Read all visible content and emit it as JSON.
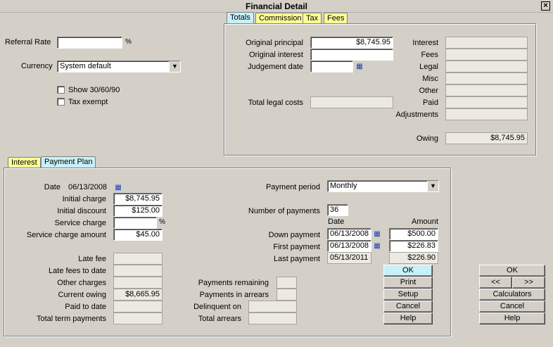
{
  "window": {
    "title": "Financial Detail",
    "close_label": "×"
  },
  "top_tabs": [
    "Totals",
    "Commission",
    "Tax",
    "Fees"
  ],
  "left_panel": {
    "referral_rate_label": "Referral Rate",
    "referral_rate_value": "",
    "percent_symbol": "%",
    "currency_label": "Currency",
    "currency_value": "System default",
    "show_30_60_90_label": "Show 30/60/90",
    "tax_exempt_label": "Tax exempt"
  },
  "totals": {
    "original_principal_label": "Original principal",
    "original_principal_value": "$8,745.95",
    "original_interest_label": "Original interest",
    "original_interest_value": "",
    "judgement_date_label": "Judgement date",
    "judgement_date_value": "",
    "total_legal_costs_label": "Total legal costs",
    "total_legal_costs_value": "",
    "interest_label": "Interest",
    "fees_label": "Fees",
    "legal_label": "Legal",
    "misc_label": "Misc",
    "other_label": "Other",
    "paid_label": "Paid",
    "adjustments_label": "Adjustments",
    "owing_label": "Owing",
    "owing_value": "$8,745.95"
  },
  "bottom_tabs": [
    "Interest",
    "Payment Plan"
  ],
  "payment_plan": {
    "date_label": "Date",
    "date_value": "06/13/2008",
    "initial_charge_label": "Initial charge",
    "initial_charge_value": "$8,745.95",
    "initial_discount_label": "Initial discount",
    "initial_discount_value": "$125.00",
    "service_charge_label": "Service charge",
    "service_charge_value": "",
    "service_charge_amount_label": "Service charge amount",
    "service_charge_amount_value": "$45.00",
    "late_fee_label": "Late fee",
    "late_fees_to_date_label": "Late fees to date",
    "other_charges_label": "Other charges",
    "current_owing_label": "Current owing",
    "current_owing_value": "$8,665.95",
    "paid_to_date_label": "Paid to date",
    "total_term_payments_label": "Total term payments",
    "payment_period_label": "Payment period",
    "payment_period_value": "Monthly",
    "number_of_payments_label": "Number of payments",
    "number_of_payments_value": "36",
    "date_col_header": "Date",
    "amount_col_header": "Amount",
    "down_payment_label": "Down payment",
    "down_payment_date": "06/13/2008",
    "down_payment_amount": "$500.00",
    "first_payment_label": "First payment",
    "first_payment_date": "06/13/2008",
    "first_payment_amount": "$226.83",
    "last_payment_label": "Last payment",
    "last_payment_date": "05/13/2011",
    "last_payment_amount": "$226.90",
    "payments_remaining_label": "Payments remaining",
    "payments_in_arrears_label": "Payments in arrears",
    "delinquent_on_label": "Delinquent on",
    "total_arrears_label": "Total arrears"
  },
  "plan_buttons": {
    "ok": "OK",
    "print": "Print",
    "setup": "Setup",
    "cancel": "Cancel",
    "help": "Help"
  },
  "dialog_buttons": {
    "ok": "OK",
    "prev": "<<",
    "next": ">>",
    "calculators": "Calculators",
    "cancel": "Cancel",
    "help": "Help"
  }
}
